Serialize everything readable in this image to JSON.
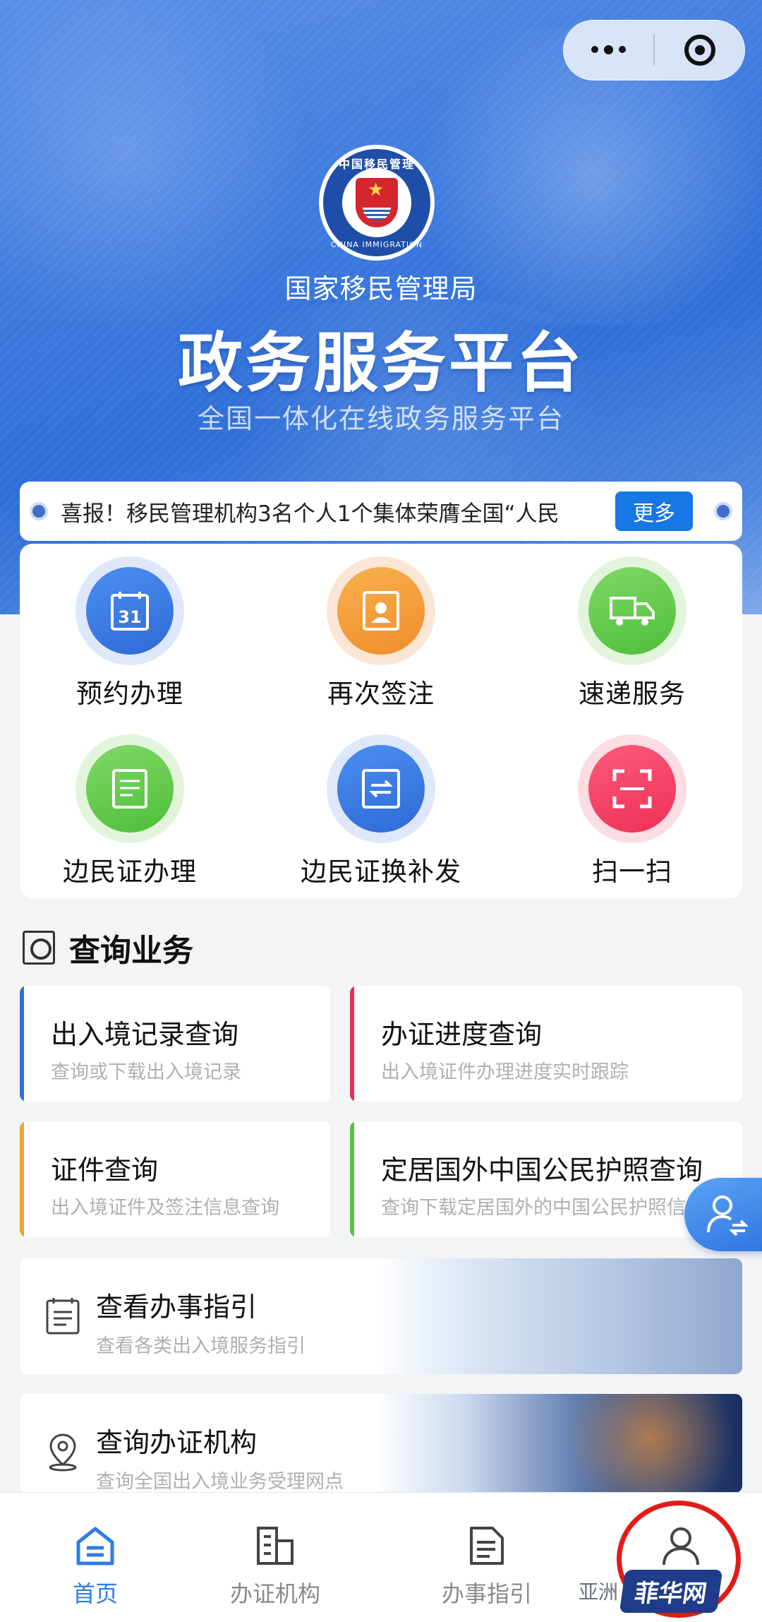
{
  "header": {
    "menu_icon": "more-dots-icon",
    "close_icon": "target-icon",
    "emblem_top_text": "中国移民管理",
    "emblem_bottom_text": "CHINA IMMIGRATION",
    "org_name": "国家移民管理局",
    "platform_title": "政务服务平台",
    "platform_subtitle": "全国一体化在线政务服务平台"
  },
  "notice": {
    "text": "喜报！移民管理机构3名个人1个集体荣膺全国“人民",
    "more_label": "更多"
  },
  "services": [
    {
      "label": "预约办理",
      "icon": "calendar-icon"
    },
    {
      "label": "再次签注",
      "icon": "id-card-icon"
    },
    {
      "label": "速递服务",
      "icon": "truck-icon"
    },
    {
      "label": "边民证办理",
      "icon": "document-icon"
    },
    {
      "label": "边民证换补发",
      "icon": "exchange-icon"
    },
    {
      "label": "扫一扫",
      "icon": "scan-icon"
    }
  ],
  "query_section": {
    "title": "查询业务",
    "cards": [
      {
        "title": "出入境记录查询",
        "subtitle": "查询或下载出入境记录",
        "color": "#2f6fd8"
      },
      {
        "title": "办证进度查询",
        "subtitle": "出入境证件办理进度实时跟踪",
        "color": "#e6304f"
      },
      {
        "title": "证件查询",
        "subtitle": "出入境证件及签注信息查询",
        "color": "#f0a030"
      },
      {
        "title": "定居国外中国公民护照查询",
        "subtitle": "查询下载定居国外的中国公民护照信息",
        "color": "#5cbf45"
      }
    ]
  },
  "wide_cards": [
    {
      "title": "查看办事指引",
      "subtitle": "查看各类出入境服务指引",
      "icon": "guide-list-icon"
    },
    {
      "title": "查询办证机构",
      "subtitle": "查询全国出入境业务受理网点",
      "icon": "location-pin-icon"
    }
  ],
  "tabbar": [
    {
      "label": "首页",
      "icon": "home-icon",
      "active": true
    },
    {
      "label": "办证机构",
      "icon": "building-icon",
      "active": false
    },
    {
      "label": "办事指引",
      "icon": "file-icon",
      "active": false
    },
    {
      "label": "",
      "icon": "user-icon",
      "active": false
    }
  ],
  "watermark": {
    "small": "亚洲",
    "brand": "菲华网"
  },
  "colors": {
    "primary": "#2f7be6",
    "notice_button": "#1677e5",
    "highlight_circle": "#e31a1a"
  }
}
